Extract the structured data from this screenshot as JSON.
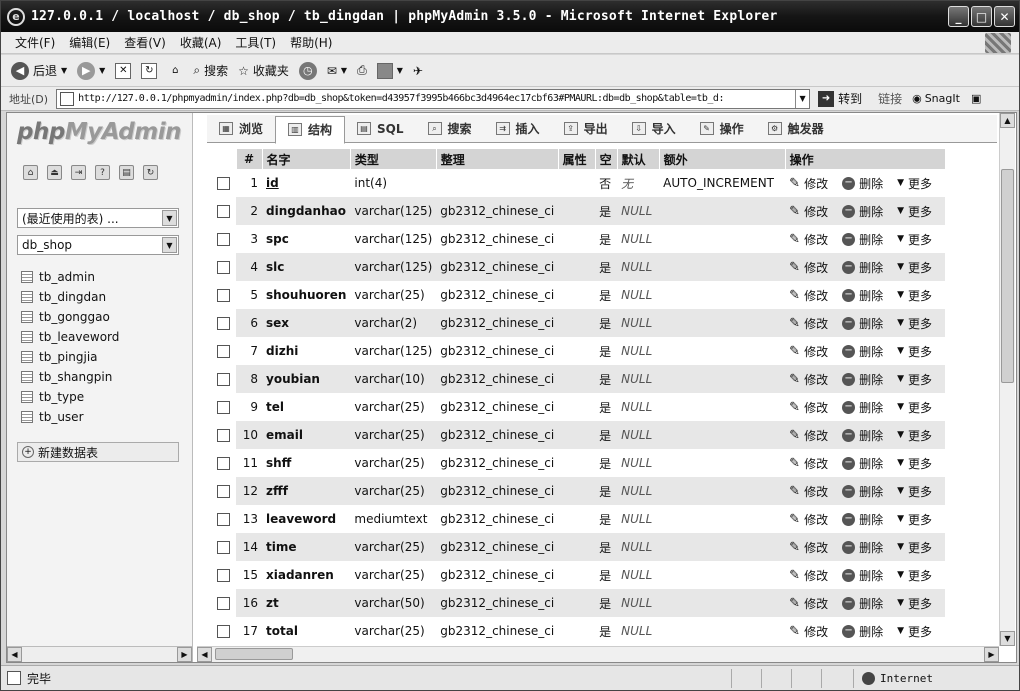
{
  "window": {
    "title": "127.0.0.1 / localhost / db_shop / tb_dingdan | phpMyAdmin 3.5.0 - Microsoft Internet Explorer"
  },
  "menubar": [
    "文件(F)",
    "编辑(E)",
    "查看(V)",
    "收藏(A)",
    "工具(T)",
    "帮助(H)"
  ],
  "toolbar": {
    "back": "后退",
    "search": "搜索",
    "favorites": "收藏夹"
  },
  "address": {
    "label": "地址(D)",
    "url": "http://127.0.0.1/phpmyadmin/index.php?db=db_shop&token=d43957f3995b466bc3d4964ec17cbf63#PMAURL:db=db_shop&table=tb_d:",
    "go": "转到",
    "links": "链接",
    "snagit": "SnagIt"
  },
  "sidebar": {
    "logo_a": "php",
    "logo_b": "MyAdmin",
    "recent_select": "(最近使用的表) ...",
    "db_select": "db_shop",
    "tables": [
      "tb_admin",
      "tb_dingdan",
      "tb_gonggao",
      "tb_leaveword",
      "tb_pingjia",
      "tb_shangpin",
      "tb_type",
      "tb_user"
    ],
    "new_table": "新建数据表"
  },
  "tabs": [
    "浏览",
    "结构",
    "SQL",
    "搜索",
    "插入",
    "导出",
    "导入",
    "操作",
    "触发器"
  ],
  "active_tab": "结构",
  "columns": [
    "#",
    "名字",
    "类型",
    "整理",
    "属性",
    "空",
    "默认",
    "额外",
    "操作"
  ],
  "actions": {
    "edit": "修改",
    "drop": "删除",
    "more": "更多"
  },
  "rows": [
    {
      "n": "1",
      "name": "id",
      "type": "int(4)",
      "collation": "",
      "attr": "",
      "null": "否",
      "default": "无",
      "extra": "AUTO_INCREMENT"
    },
    {
      "n": "2",
      "name": "dingdanhao",
      "type": "varchar(125)",
      "collation": "gb2312_chinese_ci",
      "attr": "",
      "null": "是",
      "default": "NULL",
      "extra": ""
    },
    {
      "n": "3",
      "name": "spc",
      "type": "varchar(125)",
      "collation": "gb2312_chinese_ci",
      "attr": "",
      "null": "是",
      "default": "NULL",
      "extra": ""
    },
    {
      "n": "4",
      "name": "slc",
      "type": "varchar(125)",
      "collation": "gb2312_chinese_ci",
      "attr": "",
      "null": "是",
      "default": "NULL",
      "extra": ""
    },
    {
      "n": "5",
      "name": "shouhuoren",
      "type": "varchar(25)",
      "collation": "gb2312_chinese_ci",
      "attr": "",
      "null": "是",
      "default": "NULL",
      "extra": ""
    },
    {
      "n": "6",
      "name": "sex",
      "type": "varchar(2)",
      "collation": "gb2312_chinese_ci",
      "attr": "",
      "null": "是",
      "default": "NULL",
      "extra": ""
    },
    {
      "n": "7",
      "name": "dizhi",
      "type": "varchar(125)",
      "collation": "gb2312_chinese_ci",
      "attr": "",
      "null": "是",
      "default": "NULL",
      "extra": ""
    },
    {
      "n": "8",
      "name": "youbian",
      "type": "varchar(10)",
      "collation": "gb2312_chinese_ci",
      "attr": "",
      "null": "是",
      "default": "NULL",
      "extra": ""
    },
    {
      "n": "9",
      "name": "tel",
      "type": "varchar(25)",
      "collation": "gb2312_chinese_ci",
      "attr": "",
      "null": "是",
      "default": "NULL",
      "extra": ""
    },
    {
      "n": "10",
      "name": "email",
      "type": "varchar(25)",
      "collation": "gb2312_chinese_ci",
      "attr": "",
      "null": "是",
      "default": "NULL",
      "extra": ""
    },
    {
      "n": "11",
      "name": "shff",
      "type": "varchar(25)",
      "collation": "gb2312_chinese_ci",
      "attr": "",
      "null": "是",
      "default": "NULL",
      "extra": ""
    },
    {
      "n": "12",
      "name": "zfff",
      "type": "varchar(25)",
      "collation": "gb2312_chinese_ci",
      "attr": "",
      "null": "是",
      "default": "NULL",
      "extra": ""
    },
    {
      "n": "13",
      "name": "leaveword",
      "type": "mediumtext",
      "collation": "gb2312_chinese_ci",
      "attr": "",
      "null": "是",
      "default": "NULL",
      "extra": ""
    },
    {
      "n": "14",
      "name": "time",
      "type": "varchar(25)",
      "collation": "gb2312_chinese_ci",
      "attr": "",
      "null": "是",
      "default": "NULL",
      "extra": ""
    },
    {
      "n": "15",
      "name": "xiadanren",
      "type": "varchar(25)",
      "collation": "gb2312_chinese_ci",
      "attr": "",
      "null": "是",
      "default": "NULL",
      "extra": ""
    },
    {
      "n": "16",
      "name": "zt",
      "type": "varchar(50)",
      "collation": "gb2312_chinese_ci",
      "attr": "",
      "null": "是",
      "default": "NULL",
      "extra": ""
    },
    {
      "n": "17",
      "name": "total",
      "type": "varchar(25)",
      "collation": "gb2312_chinese_ci",
      "attr": "",
      "null": "是",
      "default": "NULL",
      "extra": ""
    }
  ],
  "status": {
    "text": "完毕",
    "zone": "Internet"
  }
}
